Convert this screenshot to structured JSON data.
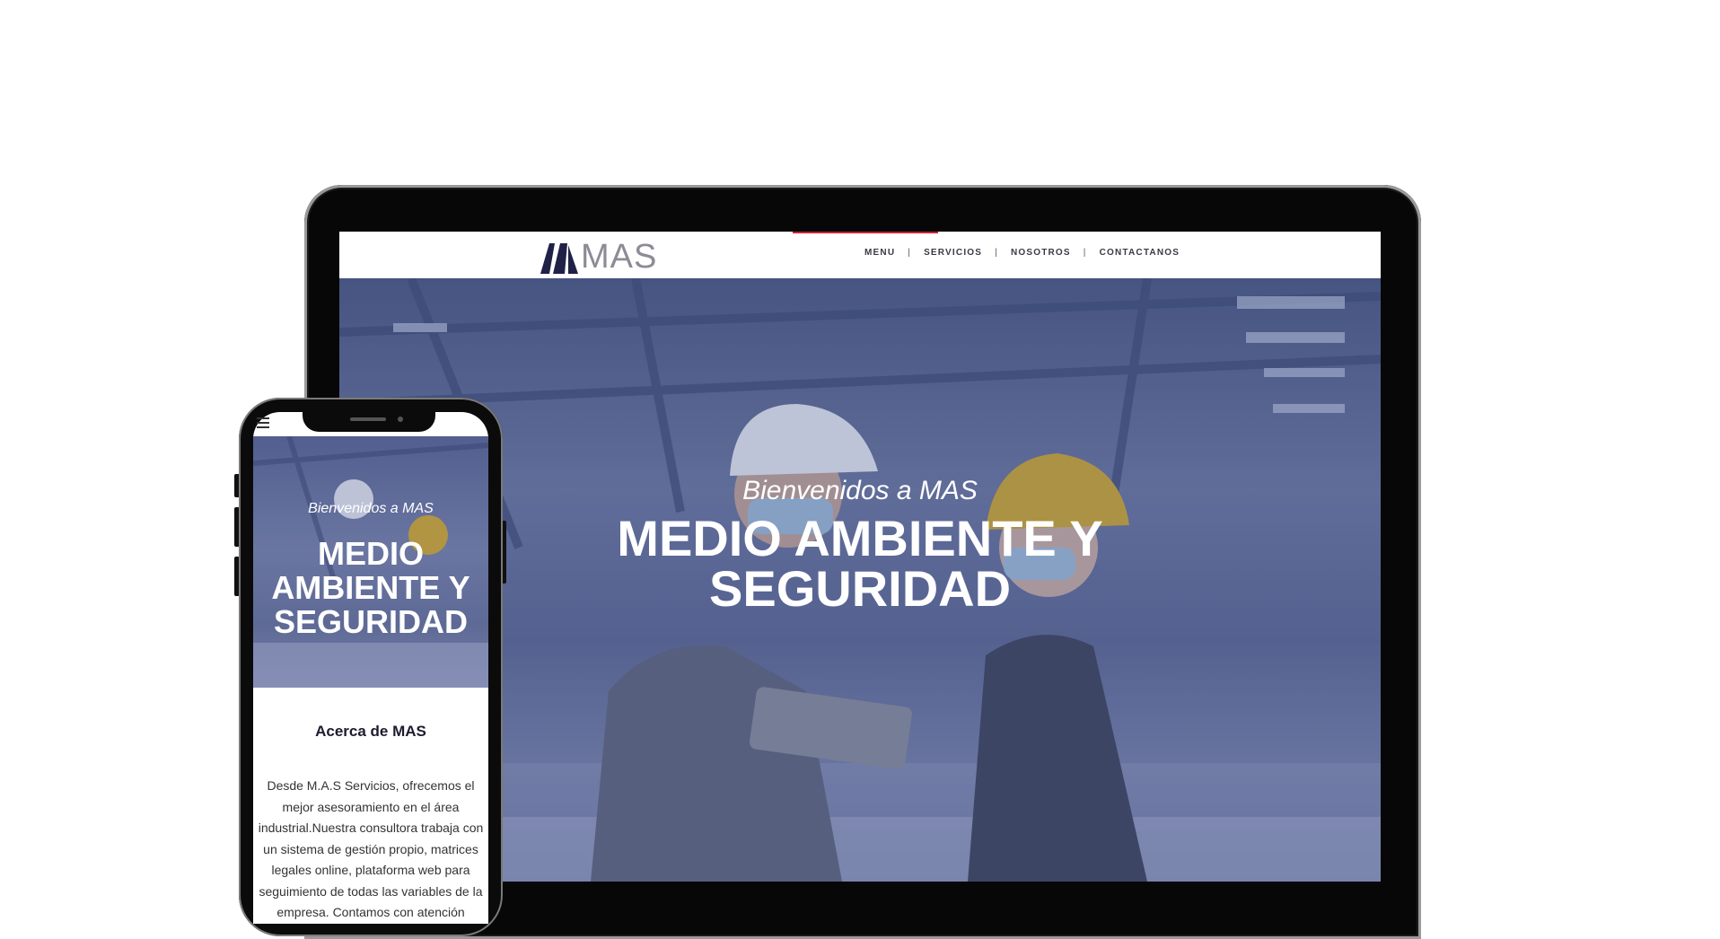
{
  "brand": {
    "logo_text": "MAS",
    "logo_color": "#1f2147",
    "accent_color": "#c62833"
  },
  "nav": {
    "items": [
      {
        "label": "MENU"
      },
      {
        "label": "SERVICIOS"
      },
      {
        "label": "NOSOTROS"
      },
      {
        "label": "CONTACTANOS"
      }
    ],
    "separator": "|"
  },
  "hero": {
    "greeting": "Bienvenidos a MAS",
    "title": "MEDIO AMBIENTE Y SEGURIDAD"
  },
  "mobile": {
    "menu_icon": "hamburger-icon",
    "greeting": "Bienvenidos a MAS",
    "title": "MEDIO AMBIENTE Y SEGURIDAD",
    "about_heading": "Acerca de MAS",
    "about_text": "Desde M.A.S Servicios, ofrecemos el mejor asesoramiento en el área industrial.Nuestra consultora trabaja con un sistema de gestión propio, matrices legales online, plataforma web para seguimiento de todas las variables de la empresa. Contamos con atención"
  }
}
